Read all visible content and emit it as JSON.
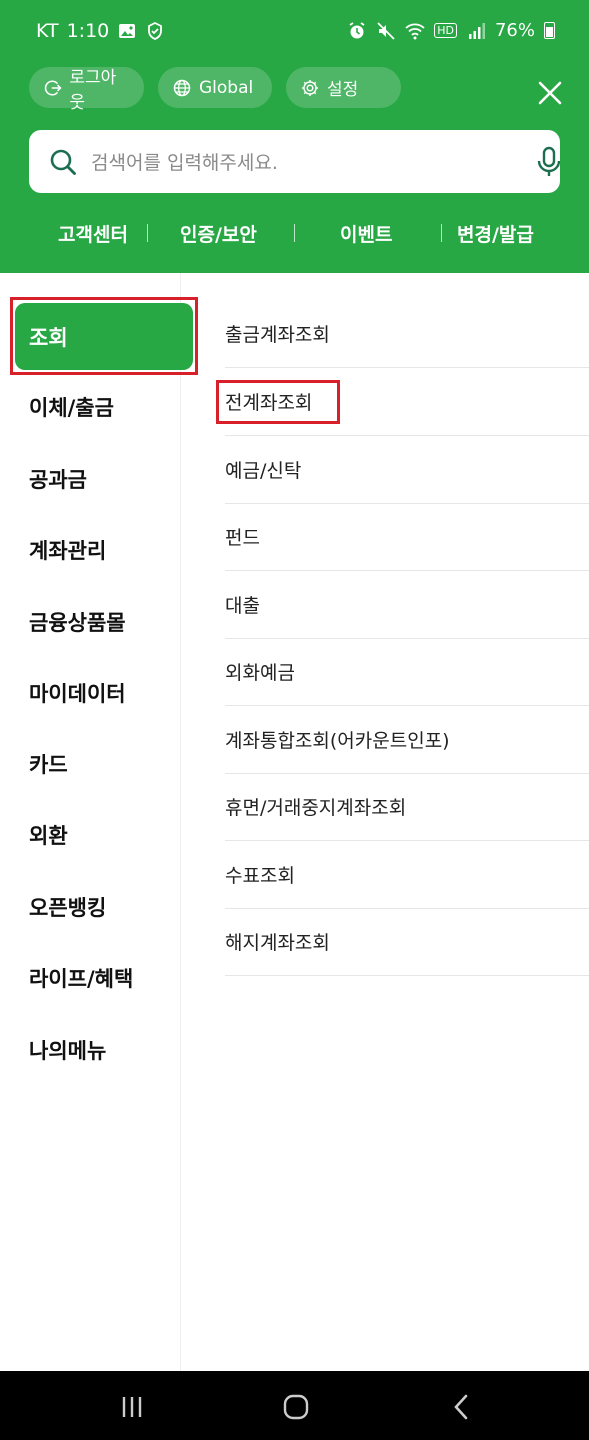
{
  "status_bar": {
    "carrier": "KT",
    "time": "1:10",
    "hd": "HD",
    "battery": "76%"
  },
  "header": {
    "logout_label": "로그아웃",
    "global_label": "Global",
    "settings_label": "설정"
  },
  "search": {
    "placeholder": "검색어를 입력해주세요."
  },
  "quick_links": [
    "고객센터",
    "인증/보안",
    "이벤트",
    "변경/발급"
  ],
  "left_menu": [
    {
      "label": "조회",
      "active": true
    },
    {
      "label": "이체/출금"
    },
    {
      "label": "공과금"
    },
    {
      "label": "계좌관리"
    },
    {
      "label": "금융상품몰"
    },
    {
      "label": "마이데이터"
    },
    {
      "label": "카드"
    },
    {
      "label": "외환"
    },
    {
      "label": "오픈뱅킹"
    },
    {
      "label": "라이프/혜택"
    },
    {
      "label": "나의메뉴"
    }
  ],
  "sub_menu": [
    "출금계좌조회",
    "전계좌조회",
    "예금/신탁",
    "펀드",
    "대출",
    "외화예금",
    "계좌통합조회(어카운트인포)",
    "휴면/거래중지계좌조회",
    "수표조회",
    "해지계좌조회"
  ],
  "colors": {
    "brand_green": "#28a745",
    "highlight_red": "#d8202a"
  }
}
